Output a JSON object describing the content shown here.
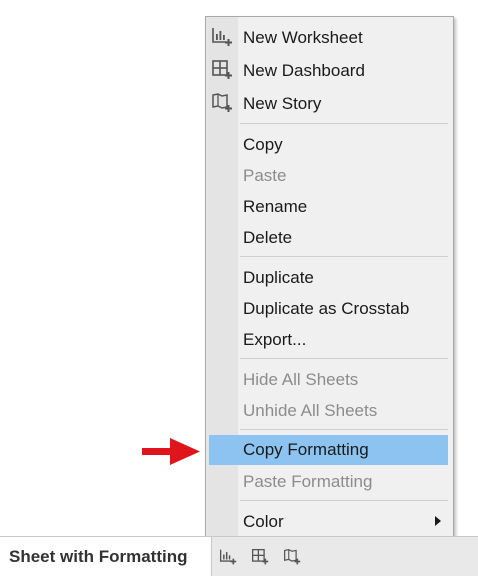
{
  "tabbar": {
    "sheet_tab_label": "Sheet with Formatting",
    "icons": [
      "new-worksheet-icon",
      "new-dashboard-icon",
      "new-story-icon"
    ]
  },
  "menu": {
    "new_worksheet": "New Worksheet",
    "new_dashboard": "New Dashboard",
    "new_story": "New Story",
    "copy": "Copy",
    "paste": "Paste",
    "rename": "Rename",
    "delete": "Delete",
    "duplicate": "Duplicate",
    "duplicate_crosstab": "Duplicate as Crosstab",
    "export": "Export...",
    "hide_all_sheets": "Hide All Sheets",
    "unhide_all_sheets": "Unhide All Sheets",
    "copy_formatting": "Copy Formatting",
    "paste_formatting": "Paste Formatting",
    "color": "Color"
  },
  "colors": {
    "highlight": "#8cc3f0",
    "pointer_arrow": "#e0151b",
    "disabled_text": "#8c8c8c"
  }
}
